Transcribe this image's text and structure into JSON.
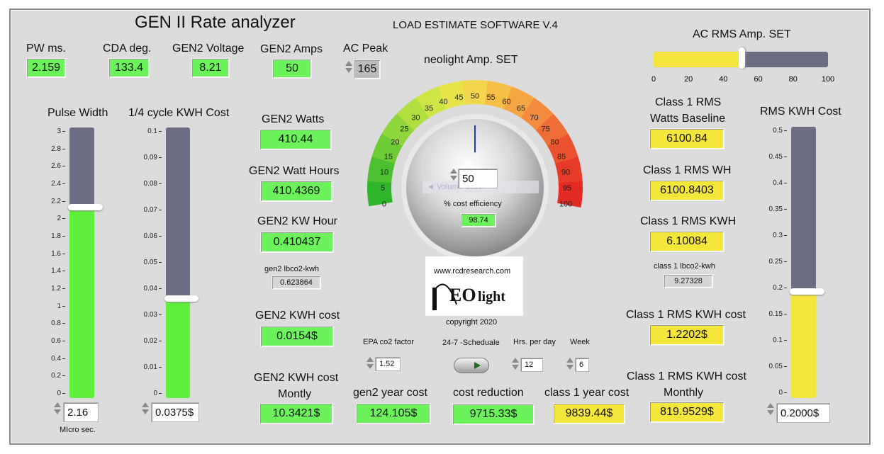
{
  "title": "GEN II Rate analyzer",
  "software": "LOAD ESTIMATE SOFTWARE V.4",
  "top": {
    "pw_label": "PW ms.",
    "pw_value": "2.159",
    "cda_label": "CDA deg.",
    "cda_value": "133.4",
    "voltage_label": "GEN2 Voltage",
    "voltage_value": "8.21",
    "amps_label": "GEN2 Amps",
    "amps_value": "50",
    "acpeak_label": "AC Peak",
    "acpeak_value": "165"
  },
  "pulse": {
    "label": "Pulse Width",
    "ticks": [
      "3",
      "2.8",
      "2.6",
      "2.4",
      "2.2",
      "2",
      "1.8",
      "1.6",
      "1.4",
      "1.2",
      "1",
      "0.8",
      "0.6",
      "0.4",
      "0.2",
      "0"
    ],
    "value": 2.16,
    "display": "2.16",
    "unit": "MIcro sec.",
    "fill_color": "#5ef03a"
  },
  "quarter": {
    "label": "1/4 cycle KWH Cost",
    "ticks": [
      "0.1",
      "0.09",
      "0.08",
      "0.07",
      "0.06",
      "0.05",
      "0.04",
      "0.03",
      "0.02",
      "0.01",
      "0"
    ],
    "value": 0.0375,
    "display": "0.0375$",
    "fill_color": "#5ef03a"
  },
  "gen2": {
    "watts_label": "GEN2 Watts",
    "watts_value": "410.44",
    "wh_label": "GEN2 Watt Hours",
    "wh_value": "410.4369",
    "kwh_label": "GEN2 KW Hour",
    "kwh_value": "0.410437",
    "lbco2_label": "gen2 lbco2-kwh",
    "lbco2_value": "0.623864",
    "cost_label": "GEN2 KWH cost",
    "cost_value": "0.0154$",
    "monthly_label_1": "GEN2 KWH cost",
    "monthly_label_2": "Montly",
    "monthly_value": "10.3421$"
  },
  "gauge": {
    "title": "neolight  Amp. SET",
    "ticks": [
      "0",
      "5",
      "10",
      "15",
      "20",
      "25",
      "30",
      "35",
      "40",
      "45",
      "50",
      "55",
      "60",
      "65",
      "70",
      "75",
      "80",
      "85",
      "90",
      "95",
      "100"
    ],
    "value": 50,
    "efficiency_label": "% cost efficiency",
    "efficiency_value": "98.74",
    "ghost_text": "◄ Volume Slider"
  },
  "logo": {
    "url": "www.rcdresearch.com",
    "brand_1": "EO",
    "brand_2": "light",
    "copyright": "copyright 2020"
  },
  "bottom": {
    "epa_label": "EPA co2 factor",
    "epa_value": "1.52",
    "schedule_label": "24-7  -Scheduale",
    "hrs_label": "Hrs. per day",
    "hrs_value": "12",
    "week_label": "Week",
    "week_value": "6",
    "year_label": "gen2 year cost",
    "year_value": "124.105$",
    "reduction_label": "cost reduction",
    "reduction_value": "9715.33$",
    "class1_year_label": "class 1 year cost",
    "class1_year_value": "9839.44$"
  },
  "ac_slider": {
    "label": "AC RMS Amp. SET",
    "ticks": [
      "0",
      "20",
      "40",
      "60",
      "80",
      "100"
    ],
    "value": 50,
    "fill_color": "#f5e63c"
  },
  "class1": {
    "baseline_label_1": "Class 1 RMS",
    "baseline_label_2": "Watts Baseline",
    "baseline_value": "6100.84",
    "wh_label": "Class 1 RMS WH",
    "wh_value": "6100.8403",
    "kwh_label": "Class 1 RMS KWH",
    "kwh_value": "6.10084",
    "lbco2_label": "class 1 lbco2-kwh",
    "lbco2_value": "9.27328",
    "cost_label": "Class 1 RMS KWH cost",
    "cost_value": "1.2202$",
    "monthly_label_1": "Class 1 RMS KWH cost",
    "monthly_label_2": "Monthly",
    "monthly_value": "819.9529$"
  },
  "rms_kwh": {
    "label": "RMS KWH Cost",
    "ticks": [
      "0.5",
      "0.45",
      "0.4",
      "0.35",
      "0.3",
      "0.25",
      "0.2",
      "0.15",
      "0.1",
      "0.05",
      "0"
    ],
    "value": 0.2,
    "display": "0.2000$",
    "fill_color": "#f5e63c"
  }
}
